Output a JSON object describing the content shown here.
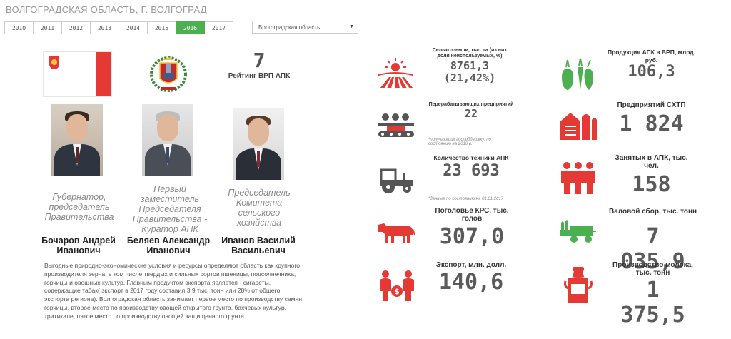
{
  "page_title": "ВОЛГОГРАДСКАЯ ОБЛАСТЬ, Г. ВОЛГОГРАД",
  "years": [
    "2010",
    "2011",
    "2012",
    "2013",
    "2014",
    "2015",
    "2016",
    "2017"
  ],
  "selected_year": "2016",
  "region_select": {
    "value": "Волгоградская область",
    "caret": "▼"
  },
  "rank": {
    "value": "7",
    "label": "Рейтинг ВРП АПК"
  },
  "people": [
    {
      "role": "Губернатор, председатель Правительства",
      "name": "Бочаров Андрей Иванович"
    },
    {
      "role": "Первый заместитель Председателя Правительства - Куратор АПК",
      "name": "Беляев Александр Иванович"
    },
    {
      "role": "Председатель Комитета сельского хозяйства",
      "name": "Иванов Василий Васильевич"
    }
  ],
  "description": "Выгодные природно-экономические условия и ресурсы определяют область как крупного производителя зерна, в том числе твердых и сильных сортов пшеницы, подсолнечника, горчицы и овощных культур. Главным продуктом экспорта является - сигареты, содержащие табак( экспорт в 2017 году составил 3,9 тыс. тонн или 28% от общего экспорта региона). Волгоградская область занимает первое место по производству семян горчицы, второе место по производству овощей открытого грунта, бахчевых культур, тритикале, пятое место по производству овощей защищенного грунта.",
  "stats": {
    "farmland": {
      "label": "Сельхозземли, тыс. га (из них доля неиспользуемых, %)",
      "value": "8761,3",
      "sub": "(21,42%)",
      "icon": "farmland-sun-icon"
    },
    "processing": {
      "label": "Перерабатывающих предприятий",
      "value": "22",
      "note": "*получающих господдержку, по состоянию на 2016 в.",
      "icon": "conveyor-icon"
    },
    "machinery": {
      "label": "Количество техники АПК",
      "value": "23 693",
      "note": "*данные по состоянию на 01.01.2017",
      "icon": "tractor-icon"
    },
    "cattle": {
      "label": "Поголовье КРС, тыс. голов",
      "value": "307,0",
      "icon": "cow-icon"
    },
    "export": {
      "label": "Экспорт, млн. долл.",
      "value": "140,6",
      "icon": "money-people-icon"
    },
    "agro_grp": {
      "label": "Продукция АПК в ВРП, млрд. руб.",
      "value": "106,3",
      "icon": "vegetables-icon"
    },
    "enterprises": {
      "label": "Предприятий СХТП",
      "value": "1 824",
      "icon": "silo-icon"
    },
    "employed": {
      "label": "Занятых в АПК, тыс. чел.",
      "value": "158",
      "icon": "workers-icon"
    },
    "harvest": {
      "label": "Валовой сбор, тыс. тонн",
      "value": "7 035,9",
      "icon": "harvest-cart-icon"
    },
    "milk": {
      "label": "Производство молока, тыс. тонн",
      "value": "1 375,5",
      "icon": "milk-can-icon"
    }
  },
  "colors": {
    "accent_red": "#e53935",
    "active_green": "#4caf50",
    "value_gray": "#5a5a5a"
  }
}
